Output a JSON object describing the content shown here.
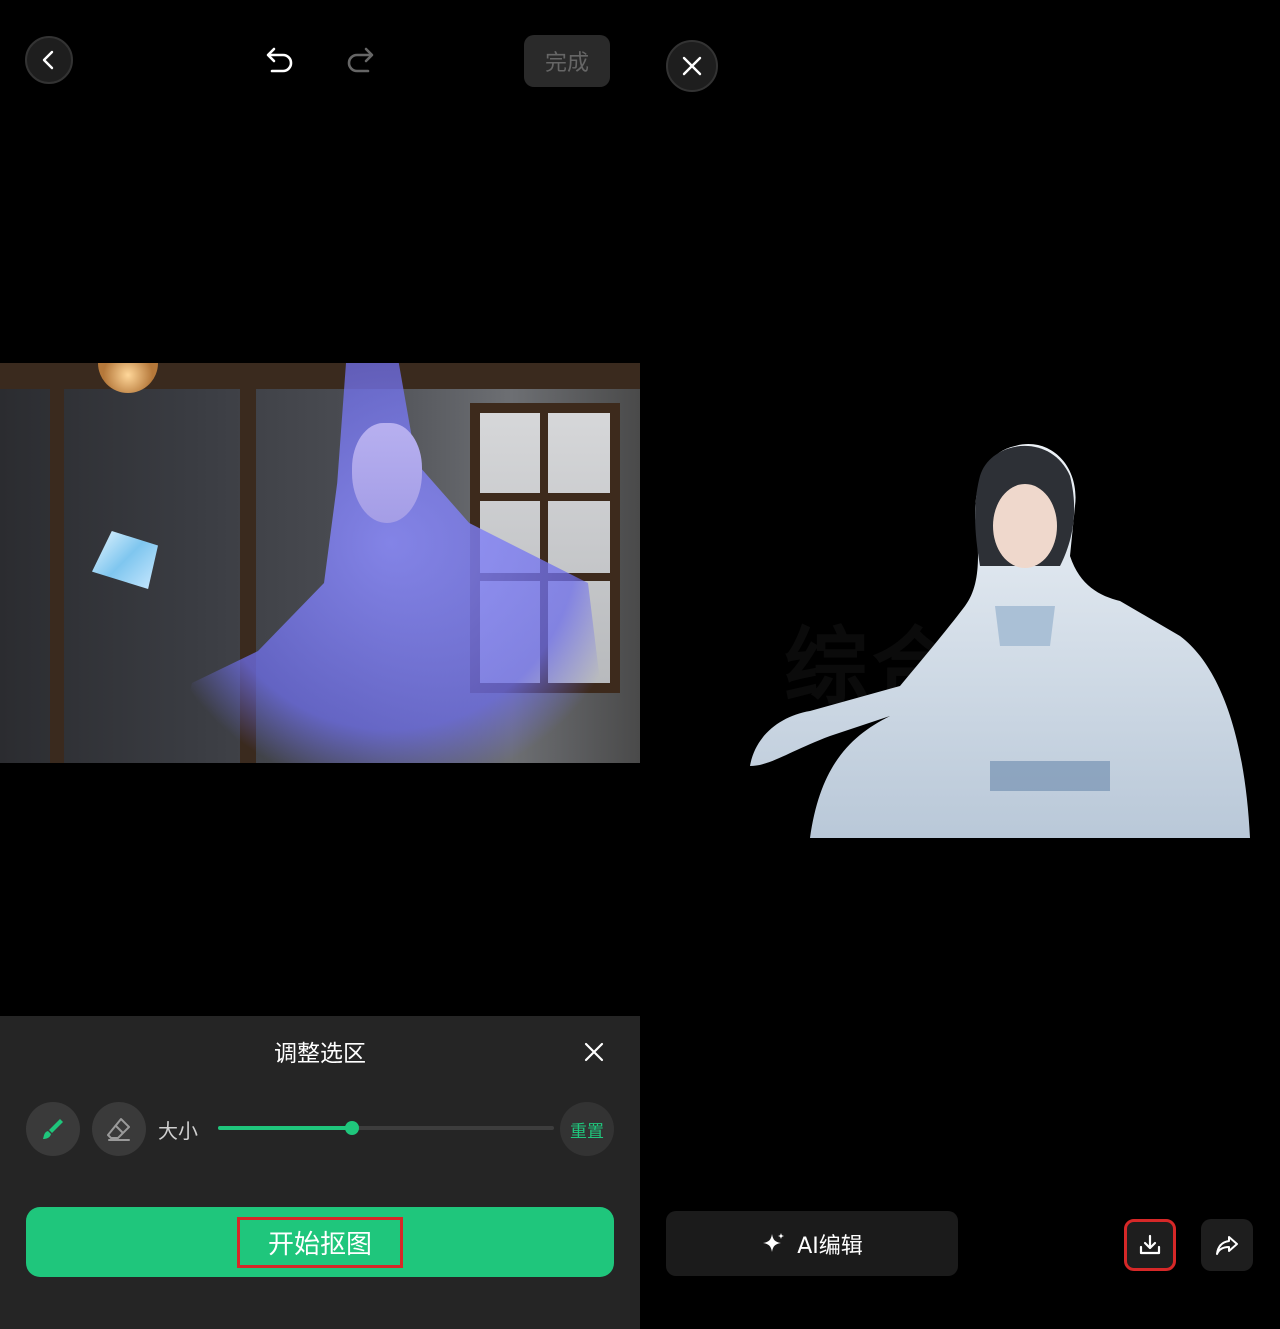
{
  "left_editor": {
    "toolbar": {
      "back_icon": "chevron-left-icon",
      "undo_icon": "undo-icon",
      "redo_icon": "redo-icon",
      "done_label": "完成"
    },
    "adjust_panel": {
      "title": "调整选区",
      "close_icon": "close-icon",
      "brush_icon": "brush-icon",
      "eraser_icon": "eraser-icon",
      "size_label": "大小",
      "size_value": 0.4,
      "reset_label": "重置",
      "start_label": "开始抠图"
    },
    "colors": {
      "accent": "#1fc67c",
      "highlight": "#d62828",
      "sheet": "#252525"
    }
  },
  "right_result": {
    "close_icon": "close-icon",
    "watermark": "综合社区",
    "ai_edit_label": "AI编辑",
    "ai_icon": "sparkle-icon",
    "download_icon": "download-icon",
    "share_icon": "share-icon"
  }
}
